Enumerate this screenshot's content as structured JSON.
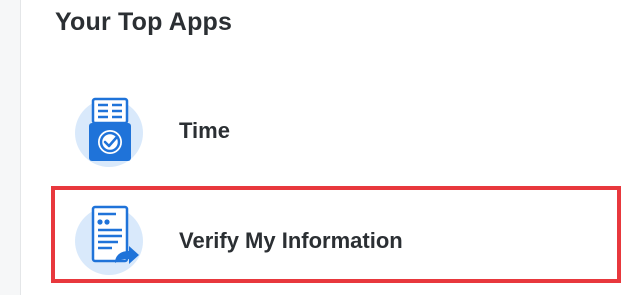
{
  "section": {
    "title": "Your Top Apps"
  },
  "apps": [
    {
      "label": "Time",
      "icon": "time-clock-icon"
    },
    {
      "label": "Verify My Information",
      "icon": "verify-form-icon"
    }
  ],
  "colors": {
    "icon_blue": "#1f73d9",
    "icon_light_bg": "#d9e9fb",
    "highlight_red": "#e8383d",
    "text_dark": "#2b2f33"
  }
}
